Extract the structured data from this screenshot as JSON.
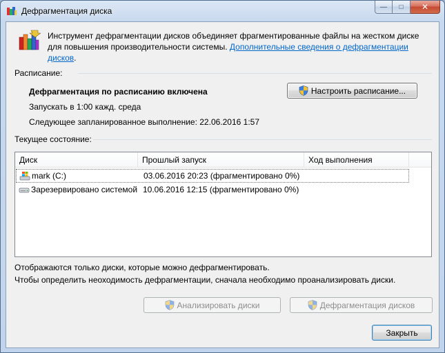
{
  "window": {
    "title": "Дефрагментация диска",
    "controls": {
      "minimize": "—",
      "maximize": "□",
      "close": "✕"
    }
  },
  "intro": {
    "text": "Инструмент дефрагментации дисков объединяет фрагментированные файлы на жестком диске для повышения производительности системы. ",
    "link": "Дополнительные сведения о дефрагментации дисков",
    "tail": "."
  },
  "schedule": {
    "section_label": "Расписание:",
    "status": "Дефрагментация по расписанию включена",
    "run_at": "Запускать в 1:00 кажд. среда",
    "next_run": "Следующее запланированное выполнение: 22.06.2016 1:57",
    "configure_button": "Настроить расписание..."
  },
  "current": {
    "section_label": "Текущее состояние:",
    "columns": [
      "Диск",
      "Прошлый запуск",
      "Ход выполнения"
    ],
    "rows": [
      {
        "disk": "mark (C:)",
        "last_run": "03.06.2016 20:23 (фрагментировано 0%)",
        "progress": "",
        "icon": "windows-drive-icon"
      },
      {
        "disk": "Зарезервировано системой",
        "last_run": "10.06.2016 12:15 (фрагментировано 0%)",
        "progress": "",
        "icon": "hard-drive-icon"
      }
    ]
  },
  "notes": {
    "line1": "Отображаются только диски, которые можно дефрагментировать.",
    "line2": "Чтобы определить неоходимость  дефрагментации, сначала необходимо проанализировать диски."
  },
  "actions": {
    "analyze": "Анализировать диски",
    "defrag": "Дефрагментация дисков",
    "close": "Закрыть"
  },
  "colors": {
    "link": "#0066cc",
    "title_bar": "#c8d9ee",
    "client_bg": "#f0f0f0"
  }
}
